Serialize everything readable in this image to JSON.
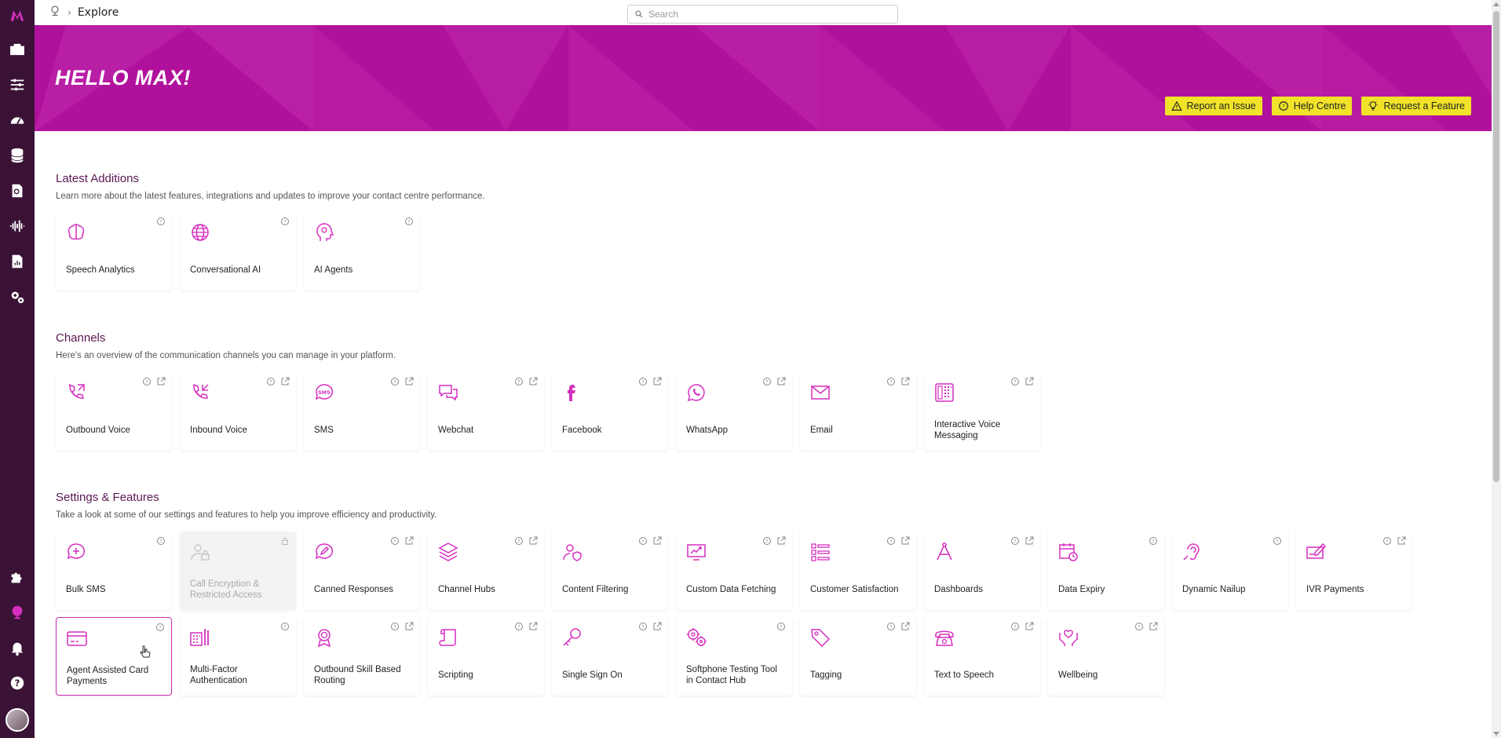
{
  "breadcrumb": {
    "current": "Explore"
  },
  "search": {
    "placeholder": "Search"
  },
  "hero": {
    "greeting": "HELLO MAX!",
    "buttons": [
      {
        "label": "Report an Issue",
        "icon": "warning-icon"
      },
      {
        "label": "Help Centre",
        "icon": "help-circle-icon"
      },
      {
        "label": "Request a Feature",
        "icon": "lightbulb-icon"
      }
    ]
  },
  "sections": {
    "latest": {
      "title": "Latest Additions",
      "description": "Learn more about the latest features, integrations and updates to improve your contact centre performance.",
      "cards": [
        {
          "label": "Speech Analytics",
          "icon": "brain-icon"
        },
        {
          "label": "Conversational AI",
          "icon": "globe-icon"
        },
        {
          "label": "AI Agents",
          "icon": "ai-head-icon"
        }
      ]
    },
    "channels": {
      "title": "Channels",
      "description": "Here's an overview of the communication channels you can manage in your platform.",
      "cards": [
        {
          "label": "Outbound Voice",
          "icon": "phone-outgoing-icon"
        },
        {
          "label": "Inbound Voice",
          "icon": "phone-incoming-icon"
        },
        {
          "label": "SMS",
          "icon": "sms-bubble-icon"
        },
        {
          "label": "Webchat",
          "icon": "chat-bubbles-icon"
        },
        {
          "label": "Facebook",
          "icon": "facebook-icon"
        },
        {
          "label": "WhatsApp",
          "icon": "whatsapp-icon"
        },
        {
          "label": "Email",
          "icon": "envelope-icon"
        },
        {
          "label": "Interactive Voice Messaging",
          "icon": "phone-keypad-icon"
        }
      ]
    },
    "settings": {
      "title": "Settings & Features",
      "description": "Take a look at some of our settings and features to help you improve efficiency and productivity.",
      "row1": [
        {
          "label": "Bulk SMS",
          "icon": "chat-plus-icon"
        },
        {
          "label": "Call Encryption & Restricted Access",
          "icon": "user-lock-icon"
        },
        {
          "label": "Canned Responses",
          "icon": "chat-pen-icon"
        },
        {
          "label": "Channel Hubs",
          "icon": "layers-icon"
        },
        {
          "label": "Content Filtering",
          "icon": "user-shield-icon"
        },
        {
          "label": "Custom Data Fetching",
          "icon": "chart-screen-icon"
        },
        {
          "label": "Customer Satisfaction",
          "icon": "rating-list-icon"
        },
        {
          "label": "Dashboards",
          "icon": "compass-icon"
        },
        {
          "label": "Data Expiry",
          "icon": "calendar-clock-icon"
        },
        {
          "label": "Dynamic Nailup",
          "icon": "ear-icon"
        },
        {
          "label": "IVR Payments",
          "icon": "cheque-pen-icon"
        }
      ],
      "row2": [
        {
          "label": "Agent Assisted Card Payments",
          "icon": "credit-card-icon"
        },
        {
          "label": "Multi-Factor Authentication",
          "icon": "keypad-icon"
        },
        {
          "label": "Outbound Skill Based Routing",
          "icon": "award-icon"
        },
        {
          "label": "Scripting",
          "icon": "scroll-icon"
        },
        {
          "label": "Single Sign On",
          "icon": "key-icon"
        },
        {
          "label": "Softphone Testing Tool in Contact Hub",
          "icon": "gears-icon"
        },
        {
          "label": "Tagging",
          "icon": "tag-icon"
        },
        {
          "label": "Text to Speech",
          "icon": "telephone-icon"
        },
        {
          "label": "Wellbeing",
          "icon": "heart-hands-icon"
        }
      ]
    }
  },
  "colors": {
    "rail": "#3a1236",
    "hero": "#b0119c",
    "accent": "#d62fbf",
    "button": "#f0e32a"
  }
}
